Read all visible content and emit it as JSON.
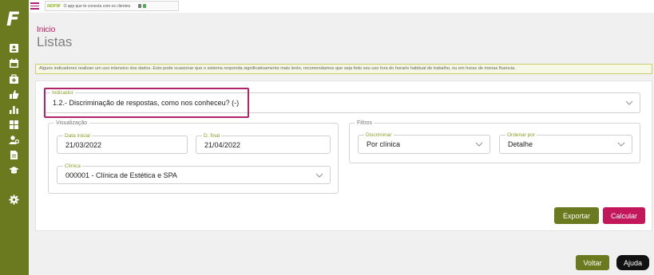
{
  "sidebar": {
    "logo": "F",
    "items": [
      {
        "icon": "id-card-icon"
      },
      {
        "icon": "calendar-icon"
      },
      {
        "icon": "medical-kit-icon"
      },
      {
        "icon": "thumbs-up-icon"
      },
      {
        "icon": "bar-chart-icon"
      },
      {
        "icon": "grid-icon"
      },
      {
        "icon": "user-settings-icon"
      },
      {
        "icon": "document-icon"
      },
      {
        "icon": "graduation-cap-icon"
      },
      {
        "icon": "gear-icon"
      }
    ]
  },
  "ad_banner": {
    "brand": "NDFW",
    "text": "O app que te conecta com os clientes"
  },
  "breadcrumb": "Inicio",
  "page_title": "Listas",
  "warning": "Alguns indicadores realizan um uso intensivo dos dados. Esto pode ocasionar que o sistema responda significativamente mais lento, recomendamos que seja feito seu uso fora do horario habitual de trabalho, ou em horas de menas fluencia.",
  "indicator": {
    "label": "Indicador",
    "value": "1.2.- Discriminação de respostas, como nos conheceu? (-)"
  },
  "visualization": {
    "legend": "Visualização",
    "start_date": {
      "label": "Data inicial",
      "value": "21/03/2022"
    },
    "end_date": {
      "label": "D. final",
      "value": "21/04/2022"
    },
    "clinic": {
      "label": "Clínica",
      "value": "000001 - Clínica de Estética e SPA"
    }
  },
  "filters": {
    "legend": "Filtros",
    "discriminate": {
      "label": "Discriminar",
      "value": "Por clínica"
    },
    "order_by": {
      "label": "Ordenar por",
      "value": "Detalhe"
    }
  },
  "buttons": {
    "export": "Exportar",
    "calculate": "Calcular",
    "back": "Voltar",
    "help": "Ajuda"
  },
  "colors": {
    "sidebar": "#6b7a1f",
    "accent_pink": "#c2185b",
    "label_green": "#8aa028"
  }
}
